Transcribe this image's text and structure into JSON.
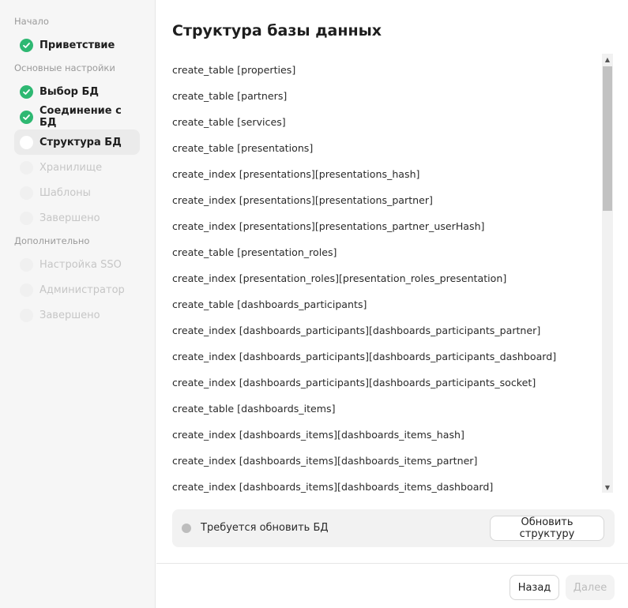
{
  "sidebar": {
    "sections": [
      {
        "label": "Начало"
      },
      {
        "label": "Основные настройки"
      },
      {
        "label": "Дополнительно"
      }
    ],
    "steps": [
      {
        "label": "Приветствие",
        "state": "done"
      },
      {
        "label": "Выбор БД",
        "state": "done"
      },
      {
        "label": "Соединение с БД",
        "state": "done"
      },
      {
        "label": "Структура БД",
        "state": "current"
      },
      {
        "label": "Хранилище",
        "state": "pending"
      },
      {
        "label": "Шаблоны",
        "state": "pending"
      },
      {
        "label": "Завершено",
        "state": "pending"
      },
      {
        "label": "Настройка SSO",
        "state": "pending"
      },
      {
        "label": "Администратор",
        "state": "pending"
      },
      {
        "label": "Завершено",
        "state": "pending"
      }
    ]
  },
  "main": {
    "title": "Структура базы данных",
    "log": [
      "create_table [properties]",
      "create_table [partners]",
      "create_table [services]",
      "create_table [presentations]",
      "create_index [presentations][presentations_hash]",
      "create_index [presentations][presentations_partner]",
      "create_index [presentations][presentations_partner_userHash]",
      "create_table [presentation_roles]",
      "create_index [presentation_roles][presentation_roles_presentation]",
      "create_table [dashboards_participants]",
      "create_index [dashboards_participants][dashboards_participants_partner]",
      "create_index [dashboards_participants][dashboards_participants_dashboard]",
      "create_index [dashboards_participants][dashboards_participants_socket]",
      "create_table [dashboards_items]",
      "create_index [dashboards_items][dashboards_items_hash]",
      "create_index [dashboards_items][dashboards_items_partner]",
      "create_index [dashboards_items][dashboards_items_dashboard]"
    ],
    "status": {
      "text": "Требуется обновить БД",
      "button_label": "Обновить структуру"
    }
  },
  "footer": {
    "back_label": "Назад",
    "next_label": "Далее"
  },
  "colors": {
    "done": "#2eb872",
    "status_dot": "#bdbdbd",
    "sidebar_bg": "#f6f6f6"
  }
}
